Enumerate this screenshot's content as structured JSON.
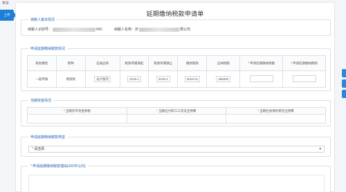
{
  "rail": {
    "top_label": "表单",
    "tab_label": "上传"
  },
  "page": {
    "title": "延期缴纳税款申请单"
  },
  "basic": {
    "legend": "纳税人基本情况",
    "id_label": "纳税人识别号：",
    "id_suffix": "54C",
    "name_label": "纳税人名称：",
    "name_prefix": "庆",
    "name_suffix": "限公司"
  },
  "apply": {
    "legend": "申请延期缴纳税款情况",
    "headers": [
      "税款属性",
      "税种",
      "征收品目",
      "税款所属期起",
      "税款所属期止",
      "缴款期限",
      "应纳税额",
      "申请延期缴纳税额",
      "申请延期缴纳期限"
    ],
    "required_cols": [
      7,
      8
    ],
    "row": {
      "attr": "一般申报",
      "tax": "增值税",
      "item": "设计服务",
      "period_start": "2018-1",
      "period_end": "2018-1",
      "deadline": "2019-01",
      "amount": "366000"
    }
  },
  "funds": {
    "legend": "当期资金情况",
    "headers": [
      "当期货币资金余额",
      "当期应付职工工资支出预算",
      "当期社会保险费支出预算"
    ]
  },
  "delay_type": {
    "legend": "申请延期缴纳税款类型",
    "selected": "请选择"
  },
  "reason": {
    "legend": "申请延期缴纳税款理由(200字以内)"
  }
}
